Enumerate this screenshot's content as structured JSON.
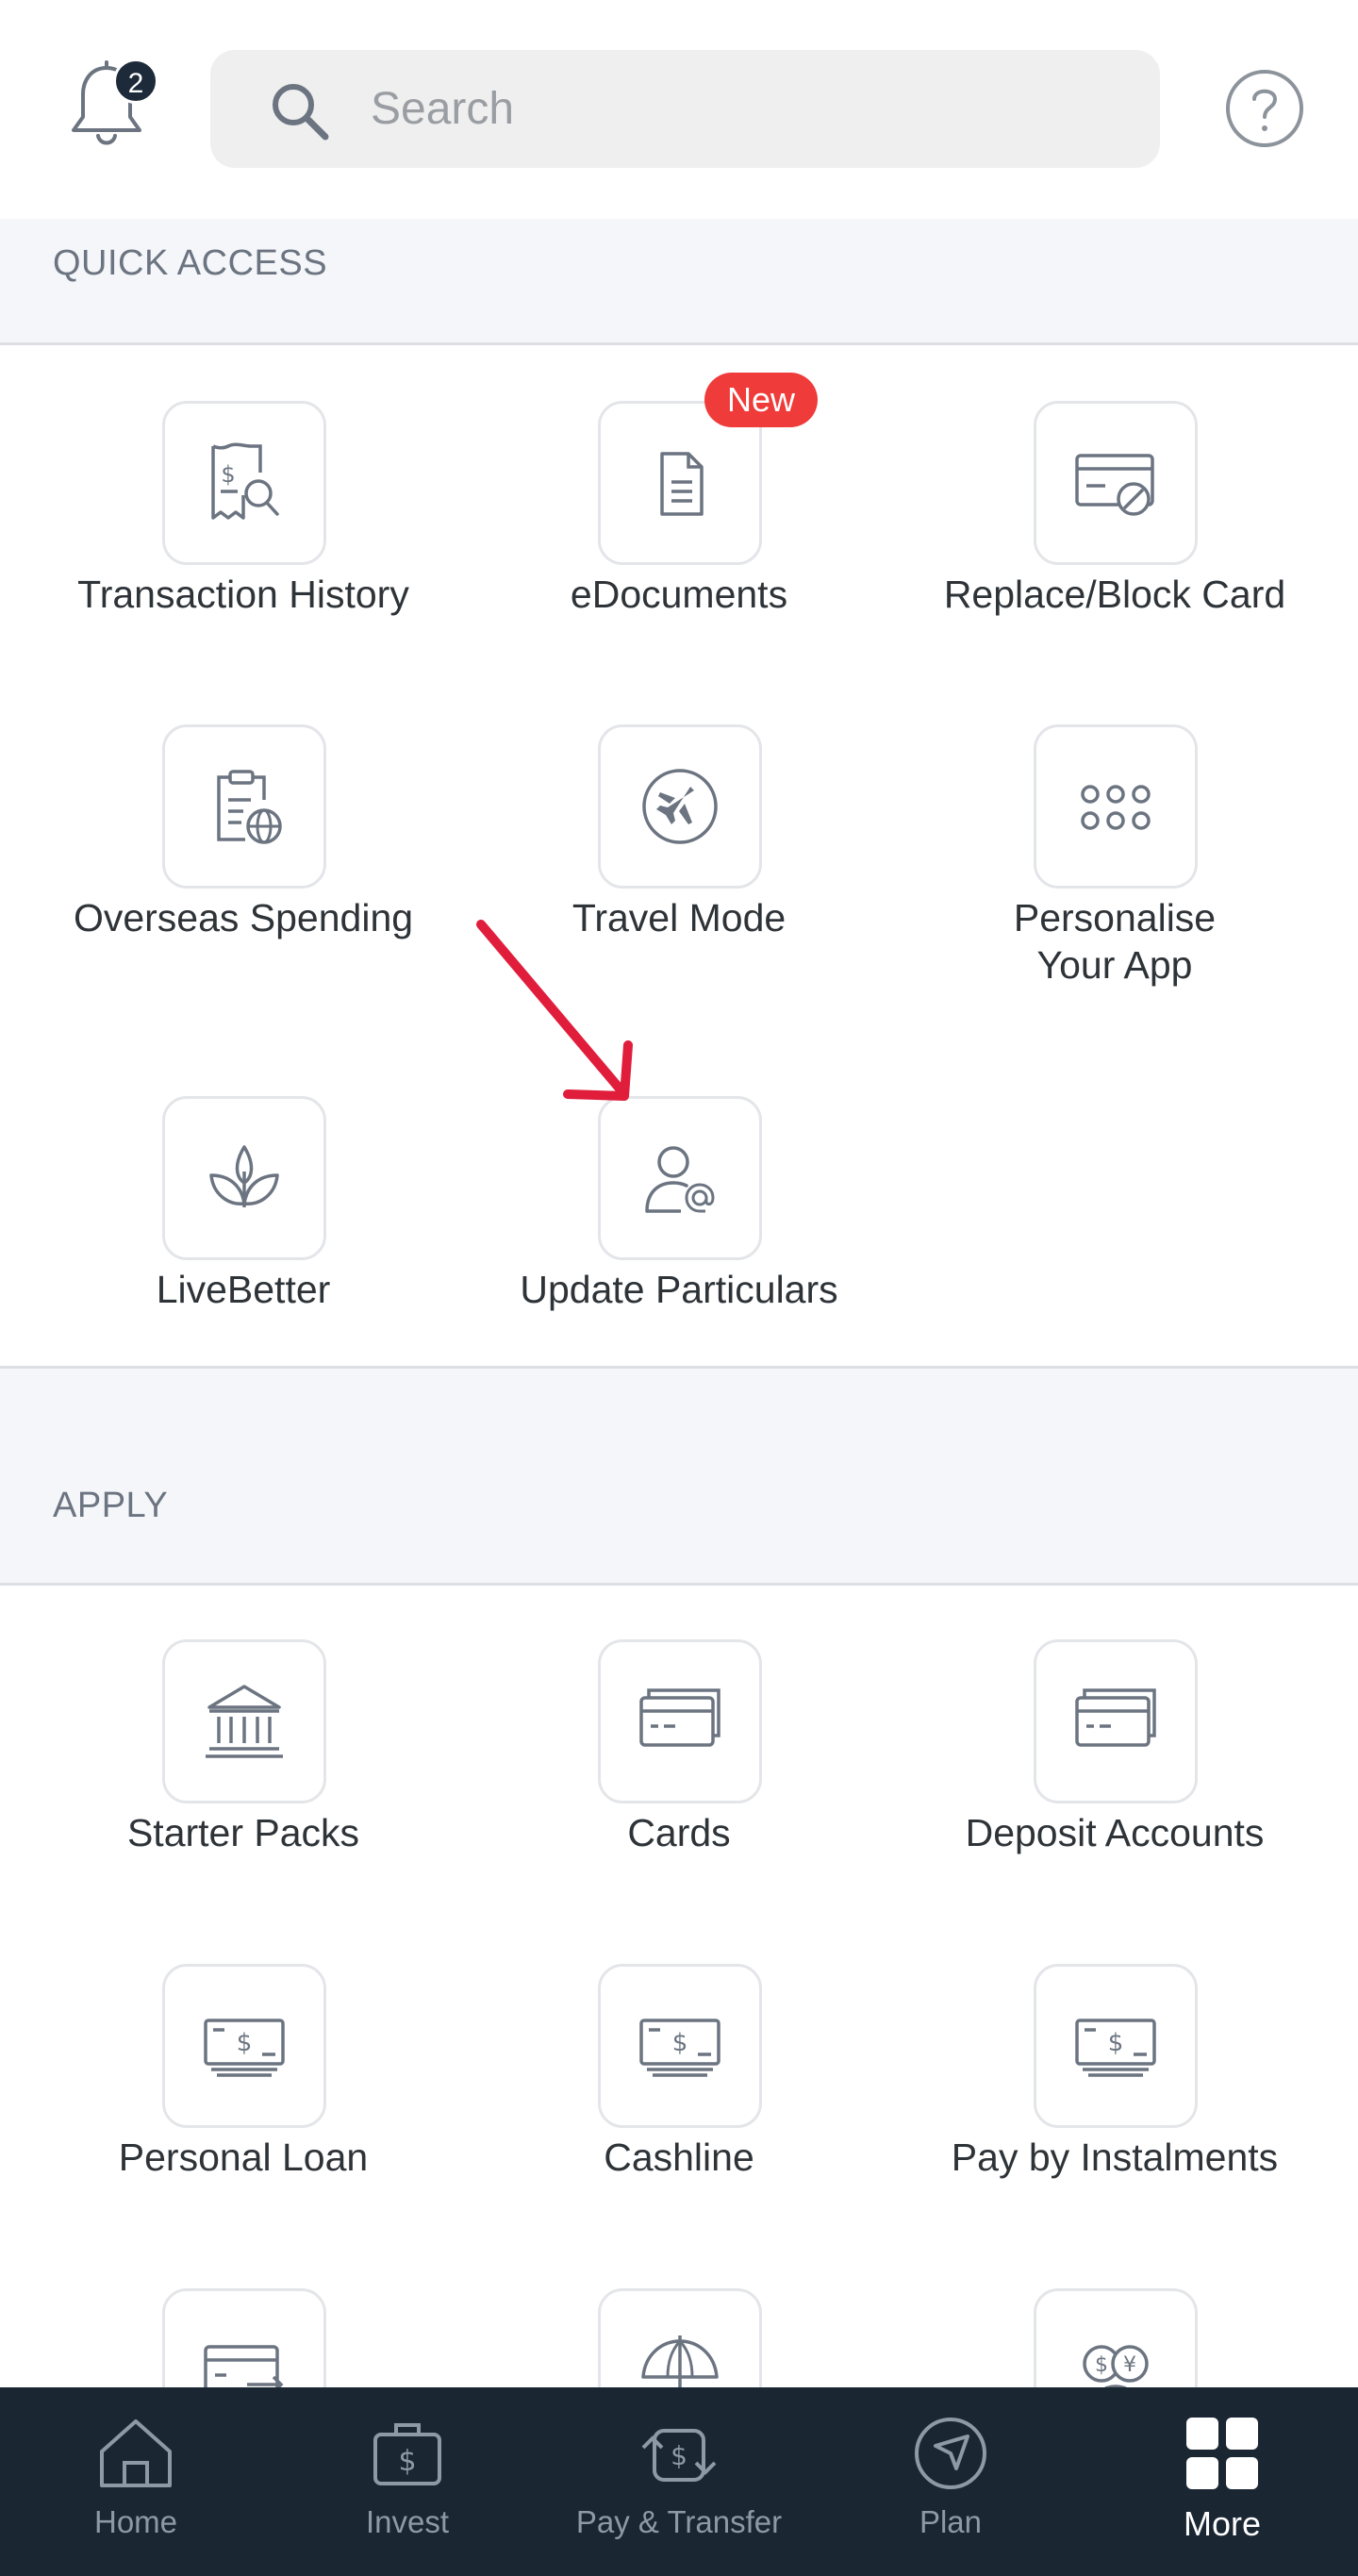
{
  "header": {
    "notification_count": "2",
    "search_placeholder": "Search"
  },
  "quick_access": {
    "title": "QUICK ACCESS",
    "items": [
      {
        "label": "Transaction History",
        "icon": "receipt-search-icon"
      },
      {
        "label": "eDocuments",
        "icon": "document-icon",
        "badge": "New"
      },
      {
        "label": "Replace/Block Card",
        "icon": "card-block-icon"
      },
      {
        "label": "Overseas Spending",
        "icon": "clipboard-globe-icon"
      },
      {
        "label": "Travel Mode",
        "icon": "airplane-icon"
      },
      {
        "label": "Personalise Your App",
        "icon": "dots-grid-icon"
      },
      {
        "label": "LiveBetter",
        "icon": "plant-icon"
      },
      {
        "label": "Update Particulars",
        "icon": "user-at-icon"
      }
    ]
  },
  "apply": {
    "title": "APPLY",
    "items": [
      {
        "label": "Starter Packs",
        "icon": "bank-icon"
      },
      {
        "label": "Cards",
        "icon": "cards-icon"
      },
      {
        "label": "Deposit Accounts",
        "icon": "cards-icon"
      },
      {
        "label": "Personal Loan",
        "icon": "cash-icon"
      },
      {
        "label": "Cashline",
        "icon": "cash-icon"
      },
      {
        "label": "Pay by Instalments",
        "icon": "cash-icon"
      }
    ]
  },
  "bottom_nav": [
    {
      "label": "Home",
      "icon": "home-icon"
    },
    {
      "label": "Invest",
      "icon": "briefcase-dollar-icon"
    },
    {
      "label": "Pay & Transfer",
      "icon": "transfer-icon"
    },
    {
      "label": "Plan",
      "icon": "compass-icon"
    },
    {
      "label": "More",
      "icon": "grid-icon",
      "active": true
    }
  ],
  "colors": {
    "badge_red": "#ef3b39",
    "nav_bg": "#1b2633",
    "section_bg": "#f4f6f9",
    "arrow_red": "#e11d3c"
  }
}
